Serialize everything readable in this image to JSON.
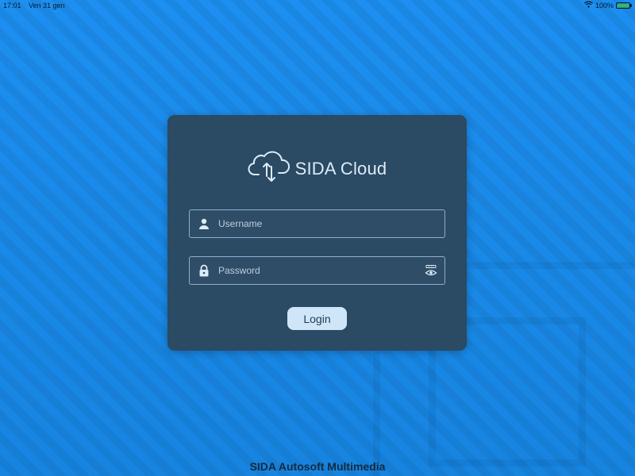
{
  "status_bar": {
    "time": "17:01",
    "date": "Ven 31 gen",
    "battery_percent": "100%",
    "battery_level": 1.0,
    "icons": [
      "wifi-icon",
      "battery-icon"
    ]
  },
  "login": {
    "brand_name": "SIDA Cloud",
    "brand_icon": "cloud-sync-icon",
    "username": {
      "placeholder": "Username",
      "value": "",
      "icon": "user-icon"
    },
    "password": {
      "placeholder": "Password",
      "value": "",
      "icon": "lock-icon",
      "toggle_icon": "eye-icon"
    },
    "login_label": "Login"
  },
  "footer": {
    "text": "SIDA Autosoft Multimedia"
  },
  "colors": {
    "background": "#1a8ae6",
    "card": "#2b4a63",
    "field_border": "#8fb0c9",
    "text_light": "#dcecf9",
    "button_bg": "#cfe6f9",
    "button_text": "#1f3a52"
  }
}
